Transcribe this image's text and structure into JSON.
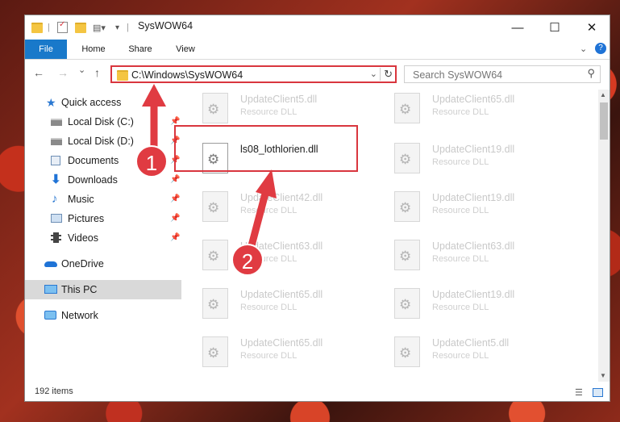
{
  "window": {
    "title": "SysWOW64",
    "minimize": "—",
    "maximize": "☐",
    "close": "✕"
  },
  "ribbon": {
    "tabs": [
      "File",
      "Home",
      "Share",
      "View"
    ],
    "expand_icon": "chevron-down-icon",
    "help": "?"
  },
  "nav": {
    "back": "←",
    "forward": "→",
    "recent": "⌄",
    "up": "↑"
  },
  "address": {
    "path": "C:\\Windows\\SysWOW64",
    "dropdown": "⌄",
    "refresh": "↻"
  },
  "search": {
    "placeholder": "Search SysWOW64",
    "icon": "⚲"
  },
  "sidebar": {
    "items": [
      {
        "label": "Quick access",
        "icon": "star-icon",
        "color": "#2a78d1"
      },
      {
        "label": "Local Disk (C:)",
        "icon": "drive-icon",
        "color": "#8a8a8a"
      },
      {
        "label": "Local Disk (D:)",
        "icon": "drive-icon",
        "color": "#8a8a8a"
      },
      {
        "label": "Documents",
        "icon": "documents-icon",
        "color": "#6e8fb5"
      },
      {
        "label": "Downloads",
        "icon": "download-arrow-icon",
        "color": "#1f73d6"
      },
      {
        "label": "Music",
        "icon": "music-note-icon",
        "color": "#2a78d1"
      },
      {
        "label": "Pictures",
        "icon": "pictures-icon",
        "color": "#6e8fb5"
      },
      {
        "label": "Videos",
        "icon": "film-icon",
        "color": "#444444"
      },
      {
        "label": "OneDrive",
        "icon": "cloud-icon",
        "color": "#1f73d6"
      },
      {
        "label": "This PC",
        "icon": "monitor-icon",
        "color": "#2a78d1"
      },
      {
        "label": "Network",
        "icon": "network-icon",
        "color": "#2a78d1"
      }
    ]
  },
  "files": [
    {
      "name": "UpdateClient5.dll",
      "type": "Resource DLL"
    },
    {
      "name": "UpdateClient65.dll",
      "type": "Resource DLL"
    },
    {
      "name": "ls08_lothlorien.dll",
      "type": ""
    },
    {
      "name": "UpdateClient19.dll",
      "type": "Resource DLL"
    },
    {
      "name": "UpdateClient42.dll",
      "type": "Resource DLL"
    },
    {
      "name": "UpdateClient19.dll",
      "type": "Resource DLL"
    },
    {
      "name": "UpdateClient63.dll",
      "type": "Resource DLL"
    },
    {
      "name": "UpdateClient63.dll",
      "type": "Resource DLL"
    },
    {
      "name": "UpdateClient65.dll",
      "type": "Resource DLL"
    },
    {
      "name": "UpdateClient19.dll",
      "type": "Resource DLL"
    },
    {
      "name": "UpdateClient65.dll",
      "type": "Resource DLL"
    },
    {
      "name": "UpdateClient5.dll",
      "type": "Resource DLL"
    }
  ],
  "status": {
    "count": "192 items"
  },
  "annotations": {
    "step1": "1",
    "step2": "2",
    "color": "#e03b42"
  }
}
